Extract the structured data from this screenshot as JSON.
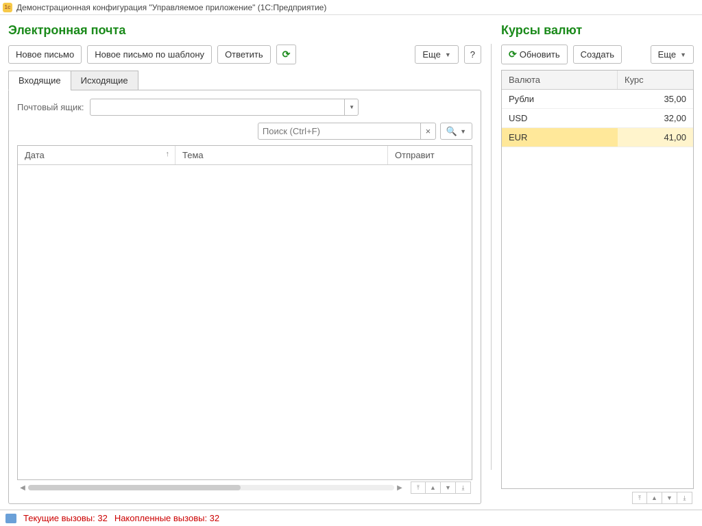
{
  "titlebar": {
    "text": "Демонстрационная конфигурация \"Управляемое приложение\"  (1С:Предприятие)"
  },
  "email": {
    "title": "Электронная почта",
    "toolbar": {
      "new_letter": "Новое письмо",
      "new_from_template": "Новое письмо по шаблону",
      "reply": "Ответить",
      "more": "Еще",
      "help": "?"
    },
    "tabs": {
      "inbox": "Входящие",
      "outbox": "Исходящие"
    },
    "mailbox_label": "Почтовый ящик:",
    "mailbox_value": "",
    "search_placeholder": "Поиск (Ctrl+F)",
    "columns": {
      "date": "Дата",
      "subject": "Тема",
      "sender": "Отправит"
    }
  },
  "rates": {
    "title": "Курсы валют",
    "toolbar": {
      "refresh": "Обновить",
      "create": "Создать",
      "more": "Еще"
    },
    "columns": {
      "currency": "Валюта",
      "rate": "Курс"
    },
    "rows": [
      {
        "currency": "Рубли",
        "rate": "35,00",
        "selected": false
      },
      {
        "currency": "USD",
        "rate": "32,00",
        "selected": false
      },
      {
        "currency": "EUR",
        "rate": "41,00",
        "selected": true
      }
    ]
  },
  "status": {
    "current_calls": "Текущие вызовы: 32",
    "accumulated_calls": "Накопленные вызовы: 32"
  }
}
